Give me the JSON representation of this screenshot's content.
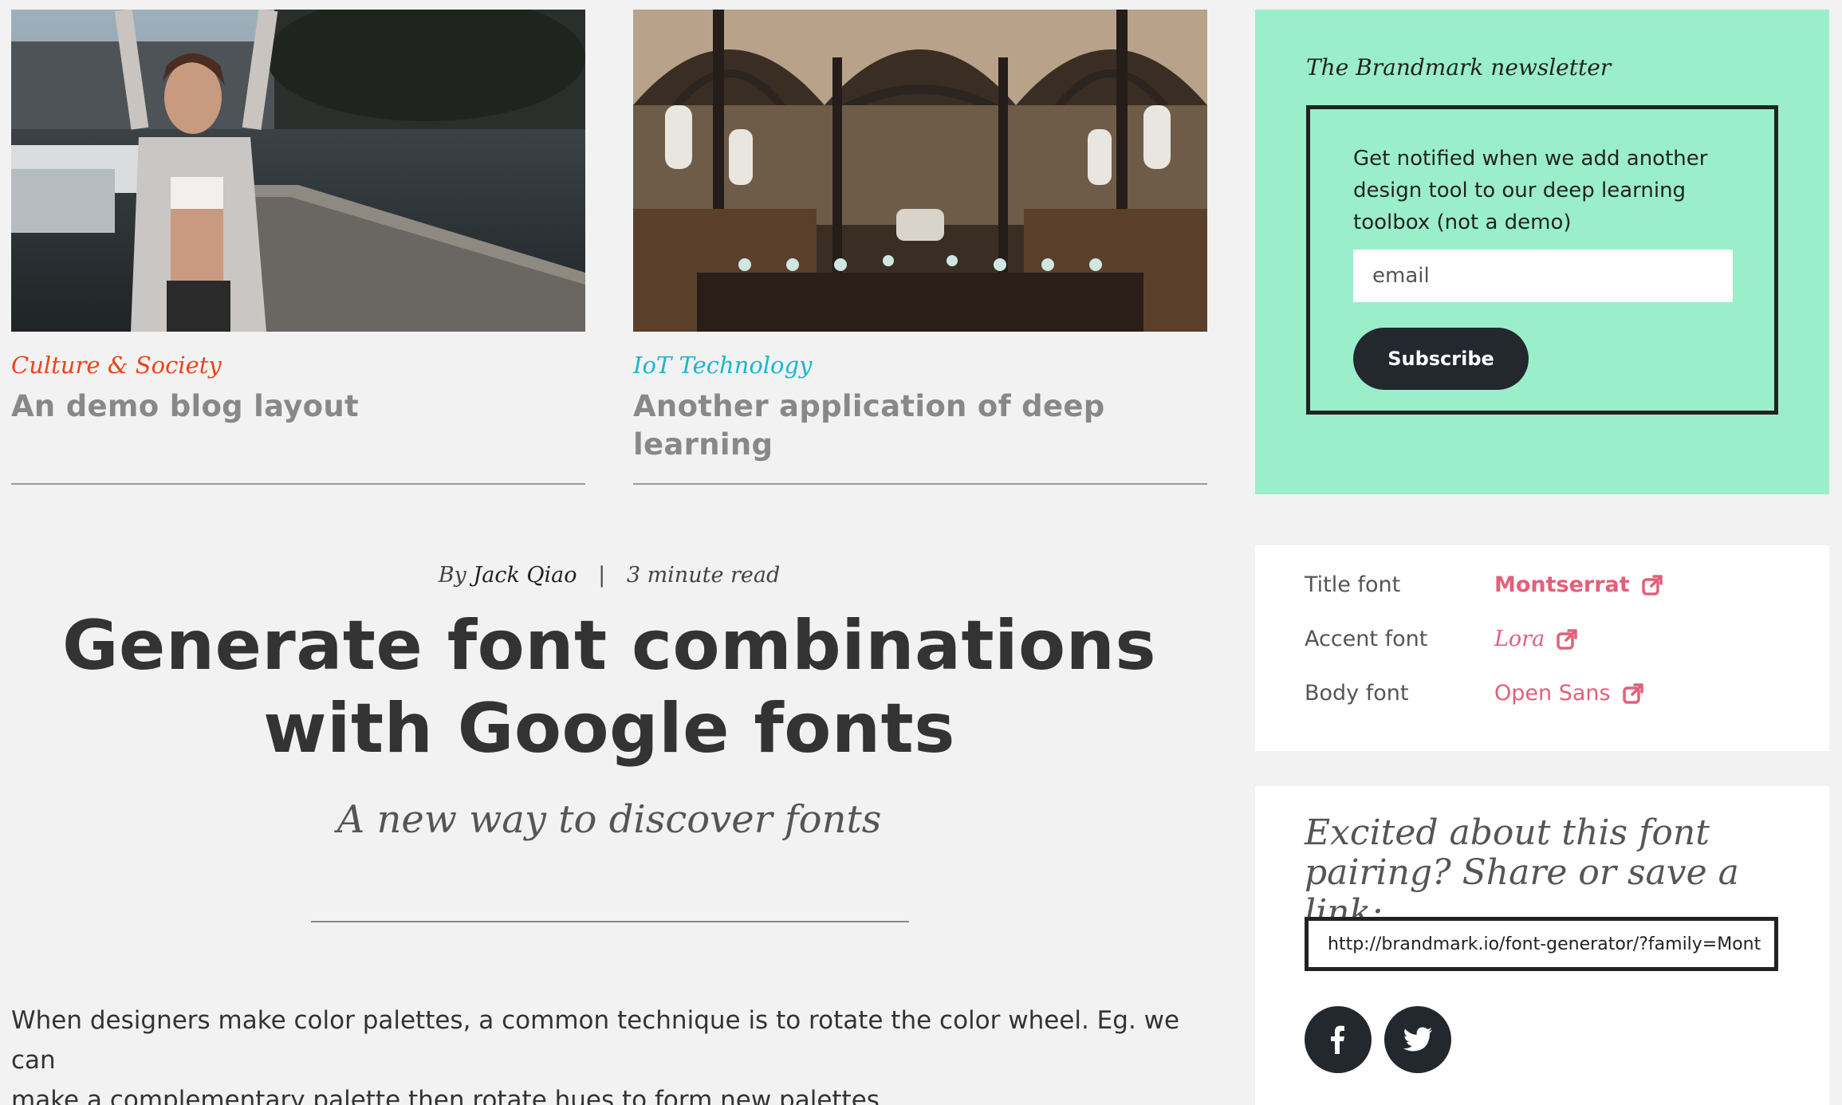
{
  "cards": [
    {
      "category": "Culture & Society",
      "category_color": "#e8451c",
      "title": "An demo blog layout",
      "image": "photo-woman-on-dock"
    },
    {
      "category": "IoT Technology",
      "category_color": "#19b7cc",
      "title": "Another application of deep learning",
      "image": "photo-library-hall"
    }
  ],
  "article": {
    "byline_prefix": "By",
    "author": "Jack Qiao",
    "separator": "|",
    "read_time": "3 minute read",
    "headline_line1": "Generate font combinations",
    "headline_line2": "with Google fonts",
    "subheading": "A new way to discover fonts",
    "body_line1": "When designers make color palettes, a common technique is to rotate the color wheel. Eg. we can",
    "body_line2": "make a complementary palette then rotate hues to form new palettes."
  },
  "newsletter": {
    "title": "The Brandmark newsletter",
    "description": "Get notified when we add another design tool to our deep learning toolbox (not a demo)",
    "email_placeholder": "email",
    "subscribe_label": "Subscribe",
    "background_color": "#9aefca"
  },
  "fonts": [
    {
      "label": "Title font",
      "name": "Montserrat",
      "icon": "external-link-icon"
    },
    {
      "label": "Accent font",
      "name": "Lora",
      "icon": "external-link-icon"
    },
    {
      "label": "Body font",
      "name": "Open Sans",
      "icon": "external-link-icon"
    }
  ],
  "share": {
    "title": "Excited about this font pairing? Share or save a link:",
    "link_value": "http://brandmark.io/font-generator/?family=Mont",
    "icons": [
      "facebook-icon",
      "twitter-icon"
    ]
  },
  "colors": {
    "link_pink": "#e2607a",
    "dark": "#23282e",
    "page_bg": "#f2f2f2"
  }
}
